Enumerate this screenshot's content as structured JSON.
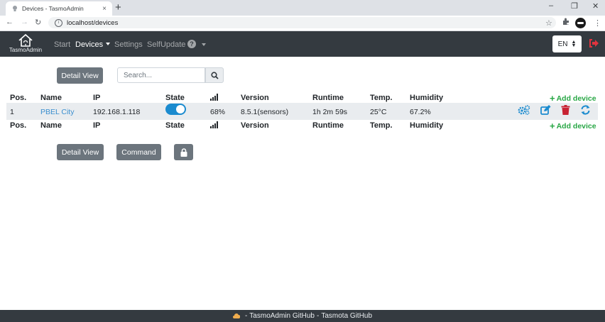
{
  "browser": {
    "tab_title": "Devices - TasmoAdmin",
    "tab_close": "×",
    "new_tab": "+",
    "url": "localhost/devices",
    "win_min": "–",
    "win_max": "❐",
    "win_close": "✕",
    "back": "←",
    "forward": "→",
    "reload": "↻",
    "bookmark": "☆",
    "menu": "⋮"
  },
  "navbar": {
    "brand": "TasmoAdmin",
    "links": {
      "start": "Start",
      "devices": "Devices",
      "settings": "Settings",
      "selfupdate": "SelfUpdate"
    },
    "help": "?",
    "language": "EN"
  },
  "toolbar_top": {
    "detail_view": "Detail View",
    "search_placeholder": "Search..."
  },
  "table": {
    "headers": {
      "pos": "Pos.",
      "name": "Name",
      "ip": "IP",
      "state": "State",
      "version": "Version",
      "runtime": "Runtime",
      "temp": "Temp.",
      "humidity": "Humidity"
    },
    "add_device": "Add device",
    "rows": [
      {
        "pos": "1",
        "name": "PBEL City",
        "ip": "192.168.1.118",
        "state_on": true,
        "signal": "68%",
        "version": "8.5.1(sensors)",
        "runtime": "1h 2m 59s",
        "temp": "25°C",
        "humidity": "67.2%"
      }
    ]
  },
  "toolbar_bottom": {
    "detail_view": "Detail View",
    "command": "Command"
  },
  "footer": {
    "left_link": "TasmoAdmin GitHub",
    "separator": "-",
    "right_link": "Tasmota GitHub"
  },
  "colors": {
    "navbar": "#343a40",
    "link_blue": "#3b8fcf",
    "add_green": "#28a745",
    "delete_red": "#c82333",
    "toggle_on": "#1b8bcf"
  },
  "icons": [
    "search-icon",
    "gears-icon",
    "edit-icon",
    "trash-icon",
    "sync-icon",
    "lock-icon",
    "signal-icon",
    "logout-icon",
    "home-icon",
    "extensions-icon"
  ]
}
